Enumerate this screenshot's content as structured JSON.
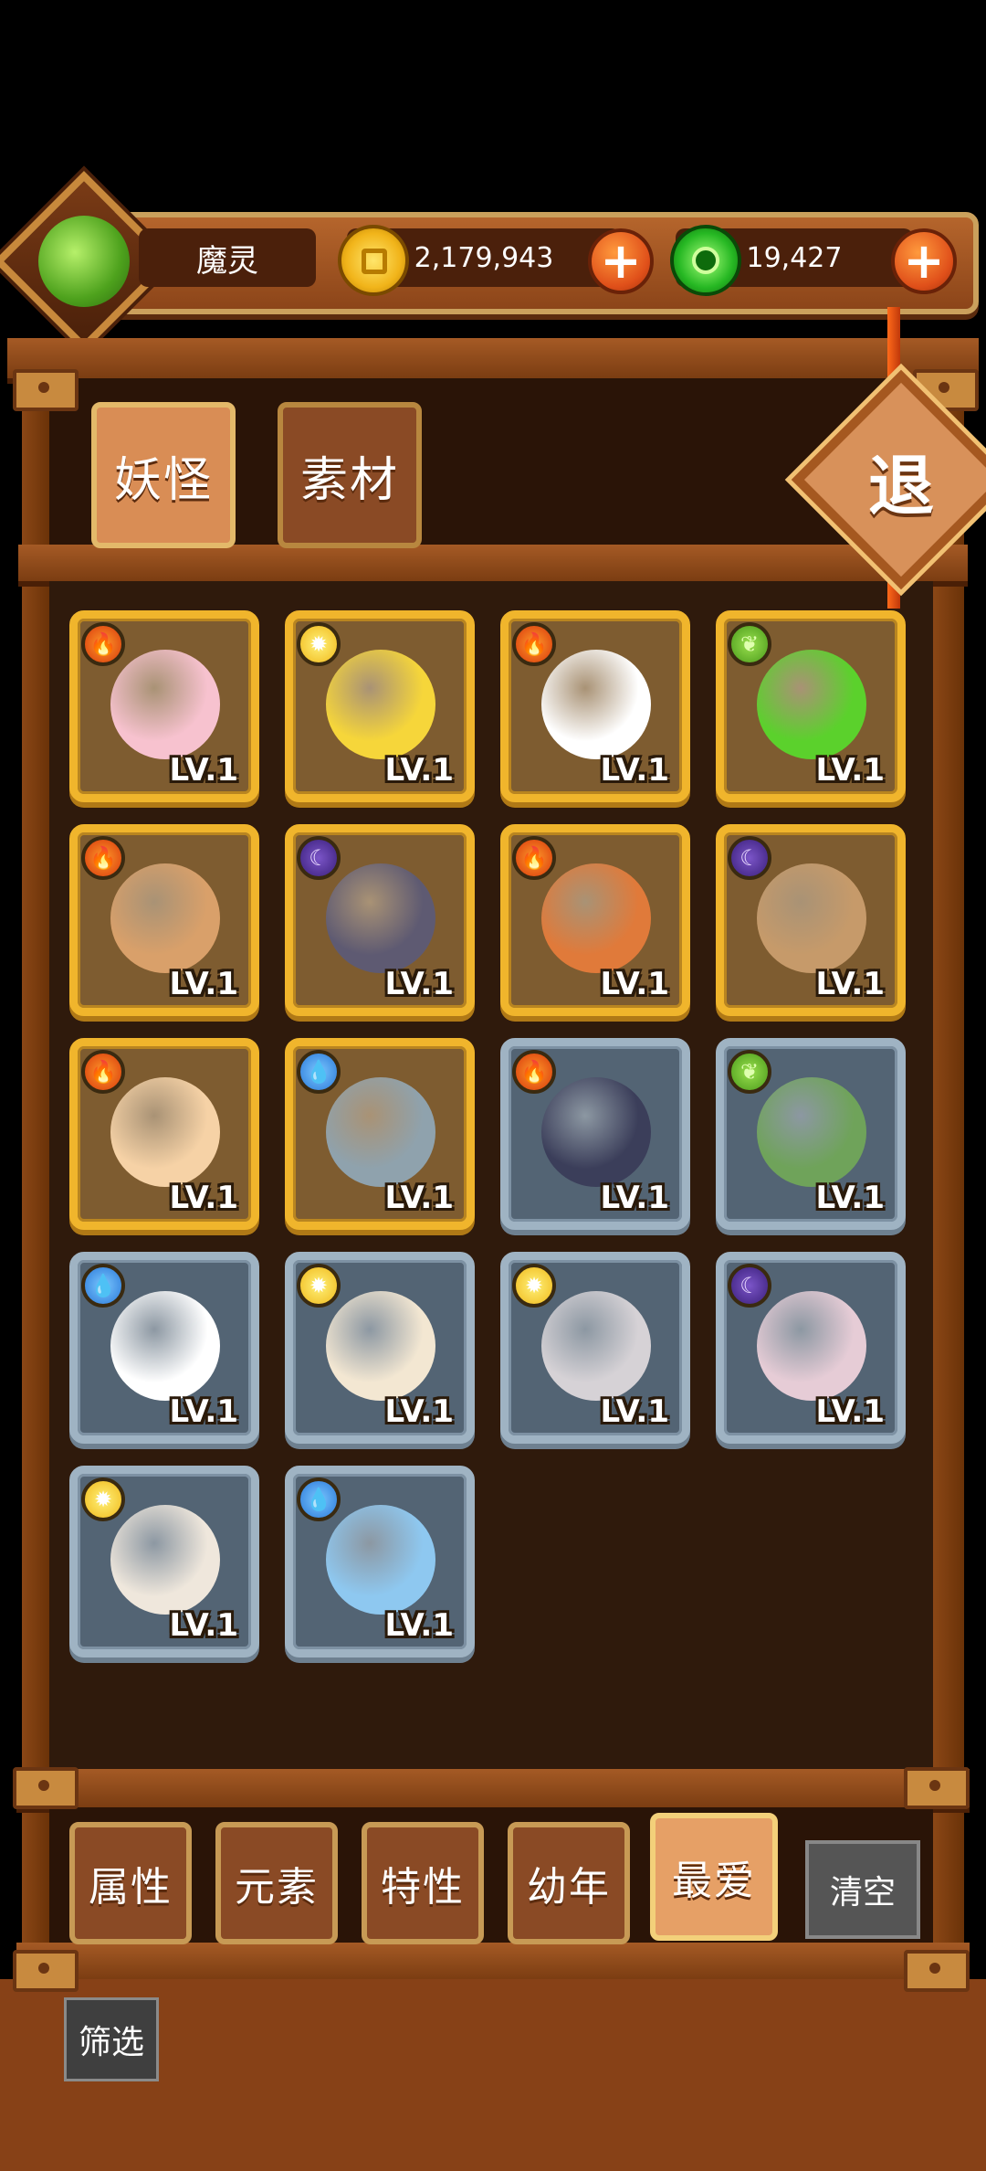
{
  "header": {
    "player_name": "魔灵",
    "gold_amount": "2,179,943",
    "gem_amount": "19,427",
    "gold_icon": "gold-coin-icon",
    "gem_icon": "green-jade-icon",
    "plus_symbol": "+"
  },
  "tabs": [
    {
      "label": "妖怪",
      "selected": true
    },
    {
      "label": "素材",
      "selected": false
    }
  ],
  "exit_label": "退",
  "monsters": [
    {
      "element": "fire",
      "frame": "gold",
      "creature": "pink-axolotl",
      "level": "LV.1",
      "color": "#f7c2cf"
    },
    {
      "element": "light",
      "frame": "gold",
      "creature": "yellow-capricorn-star",
      "level": "LV.1",
      "color": "#f6d63a"
    },
    {
      "element": "fire",
      "frame": "gold",
      "creature": "queen-of-hearts-card",
      "level": "LV.1",
      "color": "#ffffff"
    },
    {
      "element": "wood",
      "frame": "gold",
      "creature": "green-aries-star",
      "level": "LV.1",
      "color": "#5bd12c"
    },
    {
      "element": "fire",
      "frame": "gold",
      "creature": "drum-spirit",
      "level": "LV.1",
      "color": "#d9a06a"
    },
    {
      "element": "dark",
      "frame": "gold",
      "creature": "chess-general-piece",
      "level": "LV.1",
      "color": "#5e5a72"
    },
    {
      "element": "fire",
      "frame": "gold",
      "creature": "orange-fox",
      "level": "LV.1",
      "color": "#e07a3a"
    },
    {
      "element": "dark",
      "frame": "gold",
      "creature": "treasure-chest",
      "level": "LV.1",
      "color": "#c69a6a"
    },
    {
      "element": "fire",
      "frame": "gold",
      "creature": "match-stick",
      "level": "LV.1",
      "color": "#f6d2a6"
    },
    {
      "element": "water",
      "frame": "gold",
      "creature": "sword-spirit",
      "level": "LV.1",
      "color": "#8fa2ad"
    },
    {
      "element": "fire",
      "frame": "silver",
      "creature": "chess-rook",
      "level": "LV.1",
      "color": "#3b3e5a"
    },
    {
      "element": "wood",
      "frame": "silver",
      "creature": "jade-dragon-tile",
      "level": "LV.1",
      "color": "#6fa35a"
    },
    {
      "element": "water",
      "frame": "silver",
      "creature": "nine-of-diamonds-card",
      "level": "LV.1",
      "color": "#ffffff"
    },
    {
      "element": "light",
      "frame": "silver",
      "creature": "puffer-fish",
      "level": "LV.1",
      "color": "#f3e7d2"
    },
    {
      "element": "light",
      "frame": "silver",
      "creature": "grey-rabbit",
      "level": "LV.1",
      "color": "#d6d2d6"
    },
    {
      "element": "dark",
      "frame": "silver",
      "creature": "round-seal",
      "level": "LV.1",
      "color": "#e6ccd6"
    },
    {
      "element": "light",
      "frame": "silver",
      "creature": "white-bunny",
      "level": "LV.1",
      "color": "#efe7dc"
    },
    {
      "element": "water",
      "frame": "silver",
      "creature": "water-bubble",
      "level": "LV.1",
      "color": "#8ec8f0"
    }
  ],
  "filters": [
    {
      "label": "属性",
      "selected": false
    },
    {
      "label": "元素",
      "selected": false
    },
    {
      "label": "特性",
      "selected": false
    },
    {
      "label": "幼年",
      "selected": false
    },
    {
      "label": "最爱",
      "selected": true
    }
  ],
  "clear_label": "清空",
  "screen_label": "筛选",
  "element_icons": {
    "fire": "fire-icon",
    "light": "sun-icon",
    "wood": "leaf-icon",
    "dark": "moon-icon",
    "water": "water-drop-icon"
  }
}
